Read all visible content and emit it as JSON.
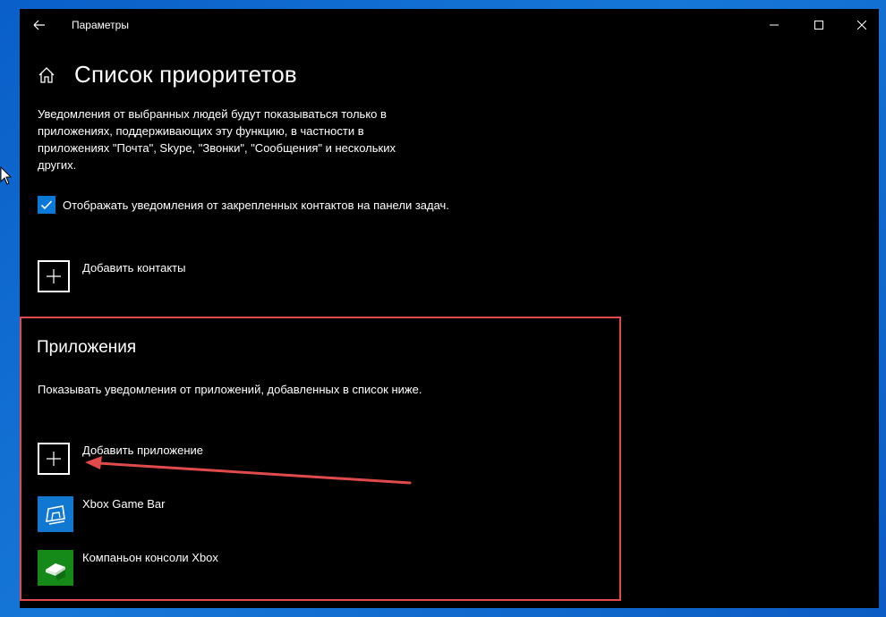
{
  "window": {
    "title": "Параметры"
  },
  "page": {
    "title": "Список приоритетов",
    "description": "Уведомления от выбранных людей будут показываться только в приложениях, поддерживающих эту функцию, в частности в приложениях \"Почта\", Skype, \"Звонки\", \"Сообщения\" и нескольких других."
  },
  "taskbar_option": {
    "label": "Отображать уведомления от закрепленных контактов на панели задач.",
    "checked": true
  },
  "contacts": {
    "add_label": "Добавить контакты"
  },
  "apps": {
    "title": "Приложения",
    "description": "Показывать уведомления от приложений, добавленных в список ниже.",
    "add_label": "Добавить приложение",
    "items": [
      {
        "name": "Xbox Game Bar",
        "tile_color": "#1078d0",
        "icon": "xbox-game-bar-icon"
      },
      {
        "name": "Компаньон консоли Xbox",
        "tile_color": "#168a18",
        "icon": "xbox-console-companion-icon"
      }
    ]
  },
  "colors": {
    "accent": "#0a78d7",
    "highlight_border": "#e04a4a",
    "desktop": "#1677d8"
  }
}
